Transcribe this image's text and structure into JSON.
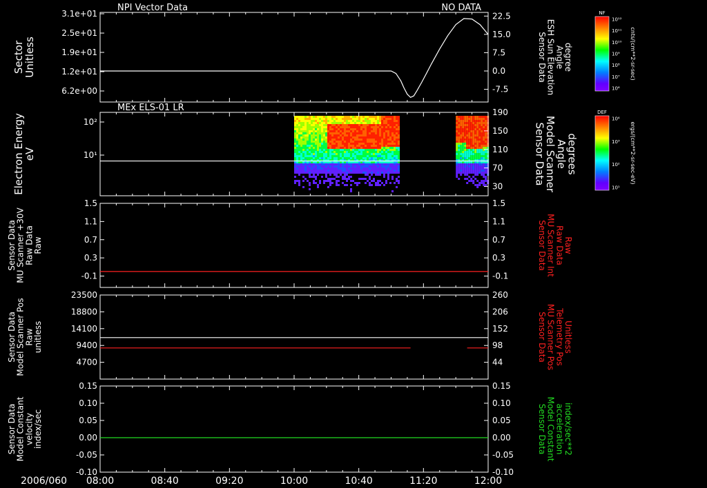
{
  "colors": {
    "background": "#000000",
    "axis": "#ffffff",
    "trace_white": "#ffffff",
    "trace_red": "#ff2020",
    "trace_green": "#22dd22",
    "label_red": "#ff2020",
    "label_green": "#22dd22"
  },
  "time_axis": {
    "date": "2006/060",
    "ticks": [
      "08:00",
      "08:40",
      "09:20",
      "10:00",
      "10:40",
      "11:20",
      "12:00"
    ],
    "minutes": [
      0,
      40,
      80,
      120,
      160,
      200,
      240
    ]
  },
  "chart_data": [
    {
      "type": "line",
      "name": "sector-panel",
      "title_left": "NPI Vector Data",
      "title_right": "NO DATA",
      "left_label": [
        "Sector",
        "Unitless"
      ],
      "left_ticks": [
        "3.1e+01",
        "2.5e+01",
        "1.9e+01",
        "1.2e+01",
        "6.2e+00"
      ],
      "right_label": [
        "Sensor Data",
        "ESH Sun Elevation",
        "Angle",
        "degree"
      ],
      "right_ticks": [
        "22.5",
        "15.0",
        "7.5",
        "0.0",
        "-7.5"
      ],
      "right_tick_values": [
        22.5,
        15.0,
        7.5,
        0.0,
        -7.5
      ],
      "ylim": [
        -12.7,
        24.0
      ],
      "series": [
        {
          "axis": "right",
          "color_key": "trace_white",
          "x": [
            0,
            100,
            180,
            183,
            186,
            188,
            190,
            192,
            194,
            196,
            199,
            202,
            205,
            210,
            215,
            220,
            225,
            230,
            235,
            240
          ],
          "y": [
            0.0,
            0.0,
            0.0,
            -1.0,
            -4.0,
            -7.0,
            -9.5,
            -10.8,
            -10.2,
            -8.0,
            -4.5,
            -0.8,
            3.0,
            9.0,
            14.5,
            19.0,
            21.5,
            21.3,
            19.0,
            15.0
          ]
        }
      ]
    },
    {
      "type": "heatmap",
      "name": "electron-energy-panel",
      "title_left": "MEx ELS-01 LR",
      "left_label": [
        "Electron Energy",
        "eV"
      ],
      "left_ticks": [
        "10²",
        "10¹"
      ],
      "right_label": [
        "Sensor Data",
        "Model Scanner",
        "Angle",
        "degrees"
      ],
      "right_ticks": [
        "190",
        "150",
        "110",
        "70",
        "30"
      ],
      "right_tick_values": [
        190,
        150,
        110,
        70,
        30
      ],
      "ylim": [
        10,
        190
      ],
      "log_energy_range": [
        0.3,
        2.3
      ],
      "data_blocks": [
        [
          120,
          185
        ],
        [
          220,
          240
        ]
      ],
      "line": {
        "axis": "right",
        "value": 85,
        "color_key": "trace_white"
      }
    },
    {
      "type": "line",
      "name": "mu-scanner-int-panel",
      "left_label": [
        "Sensor Data",
        "MU Scanner +30V",
        "Raw Data",
        "Raw"
      ],
      "left_ticks": [
        "1.5",
        "1.1",
        "0.7",
        "0.3",
        "-0.1"
      ],
      "left_tick_values": [
        1.5,
        1.1,
        0.7,
        0.3,
        -0.1
      ],
      "right_label": [
        "Sensor Data",
        "MU Scanner Int",
        "Raw Data",
        "Raw"
      ],
      "right_label_color_key": "label_red",
      "right_ticks": [
        "1.5",
        "1.1",
        "0.7",
        "0.3",
        "-0.1"
      ],
      "ylim": [
        -0.35,
        1.5
      ],
      "series": [
        {
          "axis": "right",
          "color_key": "trace_red",
          "x": [
            0,
            240
          ],
          "y": [
            0.0,
            0.0
          ]
        }
      ]
    },
    {
      "type": "line",
      "name": "scanner-pos-panel",
      "left_label": [
        "Sensor Data",
        "Model Scanner Pos",
        "Raw",
        "unitless"
      ],
      "left_ticks": [
        "23500",
        "18800",
        "14100",
        "9400",
        "4700"
      ],
      "left_tick_values": [
        23500,
        18800,
        14100,
        9400,
        4700
      ],
      "right_label": [
        "Sensor Data",
        "MU Scanner Pos",
        "Telemetry Pos",
        "Unitless"
      ],
      "right_label_color_key": "label_red",
      "right_ticks": [
        "260",
        "206",
        "152",
        "98",
        "44"
      ],
      "ylim": [
        0,
        23500
      ],
      "series": [
        {
          "axis": "left",
          "color_key": "trace_white",
          "x": [
            0,
            240
          ],
          "y": [
            11600,
            11600
          ]
        },
        {
          "axis": "left",
          "color_key": "trace_red",
          "x": [
            0,
            192
          ],
          "y": [
            8700,
            8700
          ]
        },
        {
          "axis": "left",
          "color_key": "trace_red",
          "x": [
            227,
            240
          ],
          "y": [
            8700,
            8700
          ]
        }
      ]
    },
    {
      "type": "line",
      "name": "constant-velocity-panel",
      "left_label": [
        "Sensor Data",
        "Model Constant",
        "velocity",
        "index/sec"
      ],
      "left_ticks": [
        "0.15",
        "0.10",
        "0.05",
        "0.00",
        "-0.05",
        "-0.10"
      ],
      "left_tick_values": [
        0.15,
        0.1,
        0.05,
        0.0,
        -0.05,
        -0.1
      ],
      "right_label": [
        "Sensor Data",
        "Model Constant",
        "acceleration",
        "index/sec**2"
      ],
      "right_label_color_key": "label_green",
      "right_ticks": [
        "0.15",
        "0.10",
        "0.05",
        "0.00",
        "-0.05",
        "-0.10"
      ],
      "ylim": [
        -0.1,
        0.15
      ],
      "series": [
        {
          "axis": "left",
          "color_key": "trace_green",
          "x": [
            0,
            240
          ],
          "y": [
            0.0,
            0.0
          ]
        }
      ]
    }
  ],
  "colorbars": [
    {
      "name": "nf-colorbar",
      "label": "NF",
      "unit": "cnts/(cm**2-sr-sec)",
      "ticks": [
        "10¹²",
        "10¹¹",
        "10¹⁰",
        "10⁹",
        "10⁸",
        "10⁷",
        "10⁶"
      ]
    },
    {
      "name": "def-colorbar",
      "label": "DEF",
      "unit": "ergs/(cm**2-sr-sec-eV)",
      "ticks": [
        "10⁴",
        "10³",
        "10²",
        "10¹"
      ]
    }
  ]
}
